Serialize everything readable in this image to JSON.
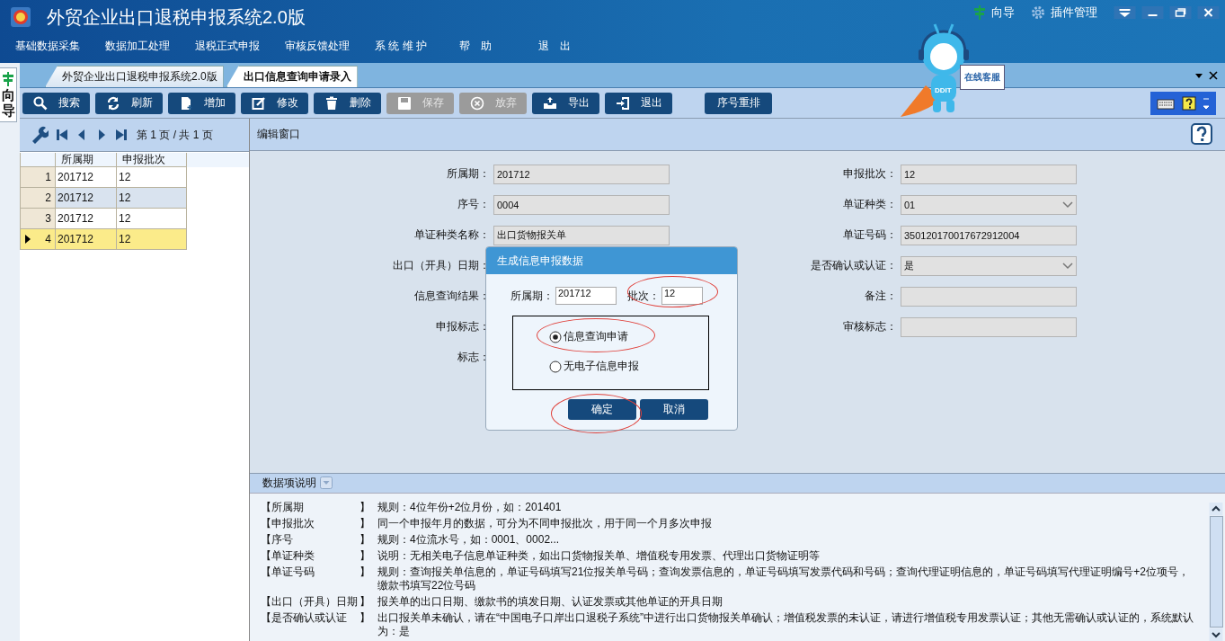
{
  "window": {
    "title": "外贸企业出口退税申报系统2.0版",
    "guide": "向导",
    "plugins": "插件管理"
  },
  "menu": [
    "基础数据采集",
    "数据加工处理",
    "退税正式申报",
    "审核反馈处理",
    "系 统 维 护",
    "帮　助",
    "退　出"
  ],
  "mascot": {
    "label": "DDIT",
    "sign": "在线客服"
  },
  "side_tab": {
    "label": "向导"
  },
  "tabs": [
    {
      "label": "外贸企业出口退税申报系统2.0版",
      "selected": false
    },
    {
      "label": "出口信息查询申请录入",
      "selected": true
    }
  ],
  "toolbar": [
    {
      "label": "搜索",
      "disabled": false
    },
    {
      "label": "刷新",
      "disabled": false
    },
    {
      "label": "增加",
      "disabled": false
    },
    {
      "label": "修改",
      "disabled": false
    },
    {
      "label": "删除",
      "disabled": false
    },
    {
      "label": "保存",
      "disabled": true
    },
    {
      "label": "放弃",
      "disabled": true
    },
    {
      "label": "导出",
      "disabled": false
    },
    {
      "label": "退出",
      "disabled": false
    },
    {
      "label": "序号重排",
      "disabled": false
    }
  ],
  "pager": "第 1 页 / 共 1 页",
  "grid": {
    "columns": [
      "所属期",
      "申报批次"
    ],
    "rows": [
      {
        "num": "1",
        "cells": [
          "201712",
          "12"
        ],
        "selected": false
      },
      {
        "num": "2",
        "cells": [
          "201712",
          "12"
        ],
        "selected": false
      },
      {
        "num": "3",
        "cells": [
          "201712",
          "12"
        ],
        "selected": false
      },
      {
        "num": "4",
        "cells": [
          "201712",
          "12"
        ],
        "selected": true
      }
    ]
  },
  "editor": {
    "title": "编辑窗口",
    "left_fields": [
      {
        "label": "所属期：",
        "kind": "text",
        "value": "201712"
      },
      {
        "label": "序号：",
        "kind": "text",
        "value": "0004"
      },
      {
        "label": "单证种类名称：",
        "kind": "text",
        "value": "出口货物报关单"
      },
      {
        "label": "出口（开具）日期：",
        "kind": "label"
      },
      {
        "label": "信息查询结果：",
        "kind": "label"
      },
      {
        "label": "申报标志：",
        "kind": "label"
      },
      {
        "label": "标志：",
        "kind": "label"
      }
    ],
    "right_fields": [
      {
        "label": "申报批次：",
        "kind": "text",
        "value": "12"
      },
      {
        "label": "单证种类：",
        "kind": "select",
        "value": "01"
      },
      {
        "label": "单证号码：",
        "kind": "text",
        "value": "350120170017672912004"
      },
      {
        "label": "是否确认或认证：",
        "kind": "select",
        "value": "是"
      },
      {
        "label": "备注：",
        "kind": "text"
      },
      {
        "label": "审核标志：",
        "kind": "text"
      }
    ]
  },
  "dialog": {
    "title": "生成信息申报数据",
    "period_label": "所属期：",
    "period": "201712",
    "batch_label": "批次：",
    "batch": "12",
    "options": [
      {
        "label": "信息查询申请",
        "selected": true
      },
      {
        "label": "无电子信息申报",
        "selected": false
      }
    ],
    "buttons": [
      "确定",
      "取消"
    ]
  },
  "help": {
    "title": "数据项说明",
    "rows": [
      {
        "key": "【所属期",
        "close": "】",
        "text": "规则：4位年份+2位月份，如：201401"
      },
      {
        "key": "【申报批次",
        "close": "】",
        "text": "同一个申报年月的数据，可分为不同申报批次，用于同一个月多次申报"
      },
      {
        "key": "【序号",
        "close": "】",
        "text": "规则：4位流水号，如：0001、0002..."
      },
      {
        "key": "【单证种类",
        "close": "】",
        "text": "说明：无相关电子信息单证种类，如出口货物报关单、增值税专用发票、代理出口货物证明等"
      },
      {
        "key": "【单证号码",
        "close": "】",
        "text": "规则：查询报关单信息的，单证号码填写21位报关单号码；查询发票信息的，单证号码填写发票代码和号码；查询代理证明信息的，单证号码填写代理证明编号+2位项号，缴款书填写22位号码"
      },
      {
        "key": "【出口（开具）日期",
        "close": "】",
        "text": "报关单的出口日期、缴款书的填发日期、认证发票或其他单证的开具日期"
      },
      {
        "key": "【是否确认或认证",
        "close": "】",
        "text": "出口报关单未确认，请在“中国电子口岸出口退税子系统”中进行出口货物报关单确认；增值税发票的未认证，请进行增值税专用发票认证；其他无需确认或认证的，系统默认为：是"
      }
    ]
  }
}
